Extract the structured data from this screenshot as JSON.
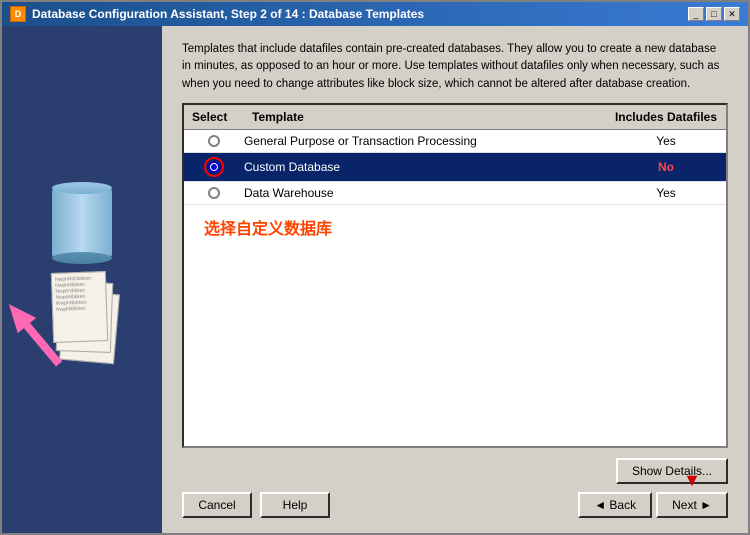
{
  "window": {
    "title": "Database Configuration Assistant, Step 2 of 14 : Database Templates",
    "icon": "D"
  },
  "titleButtons": {
    "minimize": "_",
    "restore": "□",
    "close": "✕"
  },
  "description": "Templates that include datafiles contain pre-created databases. They allow you to create a new database in minutes, as opposed to an hour or more. Use templates without datafiles only when necessary, such as when you need to change attributes like block size, which cannot be altered after database creation.",
  "table": {
    "headers": {
      "select": "Select",
      "template": "Template",
      "datafiles": "Includes Datafiles"
    },
    "rows": [
      {
        "id": "general",
        "template": "General Purpose or Transaction Processing",
        "datafiles": "Yes",
        "selected": false
      },
      {
        "id": "custom",
        "template": "Custom Database",
        "datafiles": "No",
        "selected": true
      },
      {
        "id": "warehouse",
        "template": "Data Warehouse",
        "datafiles": "Yes",
        "selected": false
      }
    ]
  },
  "annotation": "选择自定义数据库",
  "buttons": {
    "cancel": "Cancel",
    "help": "Help",
    "show_details": "Show Details...",
    "back": "◄  Back",
    "next": "Next  ►"
  }
}
